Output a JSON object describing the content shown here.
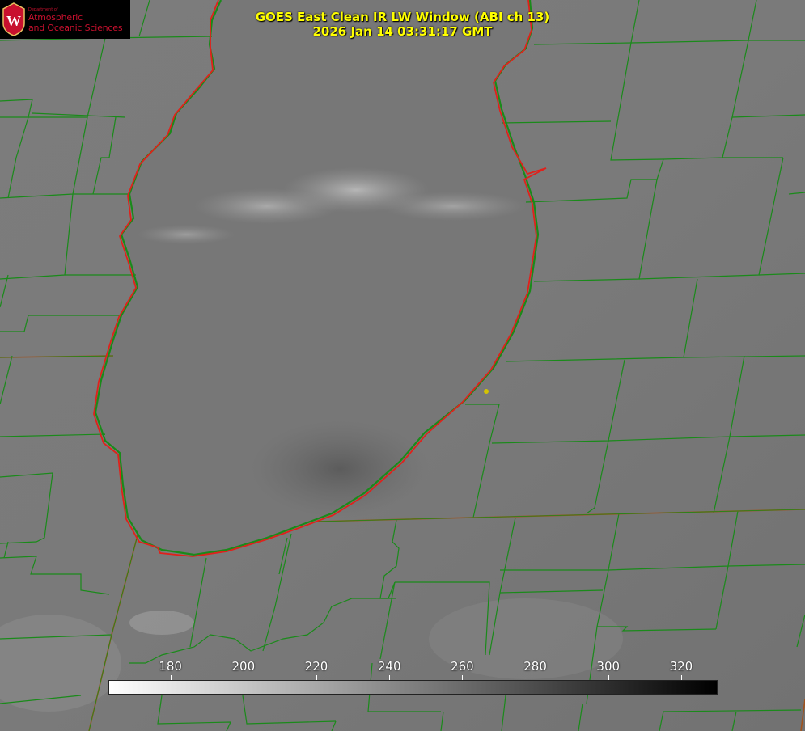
{
  "title": {
    "line1": "GOES East Clean IR LW Window (ABI ch 13)",
    "line2": "2026 Jan 14 03:31:17 GMT"
  },
  "logo": {
    "department": "Department of",
    "line1": "Atmospheric",
    "line2": "and Oceanic Sciences",
    "seal_letter": "W",
    "color": "#c8102e"
  },
  "colorbar": {
    "min": 163,
    "max": 330,
    "ticks": [
      "180",
      "200",
      "220",
      "240",
      "260",
      "280",
      "300",
      "320"
    ],
    "tick_values": [
      180,
      200,
      220,
      240,
      260,
      280,
      300,
      320
    ],
    "low_color": "#ffffff",
    "high_color": "#000000"
  },
  "colors": {
    "county_lines": "#1a8a1a",
    "state_lines": "#a0521d",
    "shoreline": "#e0211b",
    "marker": "#d4c400",
    "title_text": "#ffff00"
  }
}
